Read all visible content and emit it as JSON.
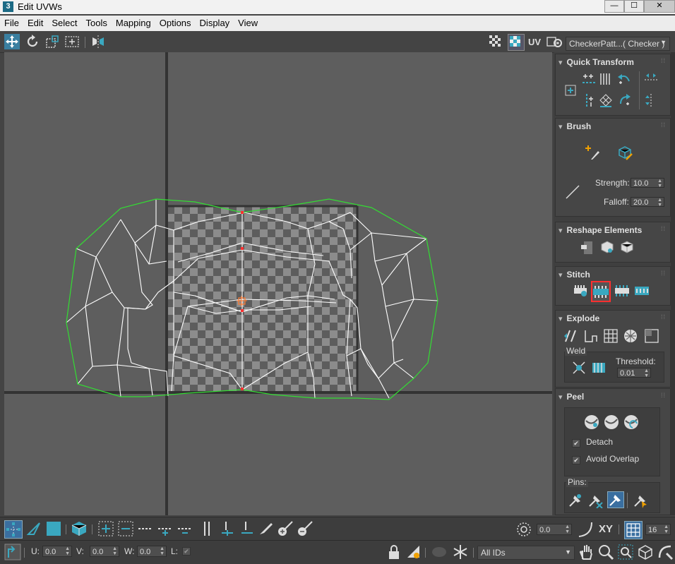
{
  "window": {
    "title": "Edit UVWs",
    "app_icon": "3",
    "minimize": "—",
    "maximize": "☐",
    "close": "✕"
  },
  "menu": [
    "File",
    "Edit",
    "Select",
    "Tools",
    "Mapping",
    "Options",
    "Display",
    "View"
  ],
  "toolbar": {
    "uv_label": "UV",
    "texture_dropdown": "CheckerPatt...( Checker )"
  },
  "quick_transform": {
    "title": "Quick Transform"
  },
  "brush": {
    "title": "Brush",
    "strength_label": "Strength:",
    "strength_value": "10.0",
    "falloff_label": "Falloff:",
    "falloff_value": "20.0"
  },
  "reshape": {
    "title": "Reshape Elements"
  },
  "stitch": {
    "title": "Stitch"
  },
  "explode": {
    "title": "Explode",
    "weld_label": "Weld",
    "threshold_label": "Threshold:",
    "threshold_value": "0.01"
  },
  "peel": {
    "title": "Peel",
    "detach_label": "Detach",
    "detach_checked": true,
    "avoid_overlap_label": "Avoid Overlap",
    "avoid_overlap_checked": true,
    "pins_label": "Pins:"
  },
  "bottom": {
    "angle_value": "0.0",
    "xy_label": "XY",
    "grid_value": "16",
    "u_label": "U:",
    "u_value": "0.0",
    "v_label": "V:",
    "v_value": "0.0",
    "w_label": "W:",
    "w_value": "0.0",
    "l_label": "L:",
    "ids_dropdown": "All IDs"
  },
  "colors": {
    "accent": "#3aa8c0",
    "selection_border": "#ff3030",
    "uv_edge": "#ffffff",
    "boundary": "#33dd33"
  }
}
